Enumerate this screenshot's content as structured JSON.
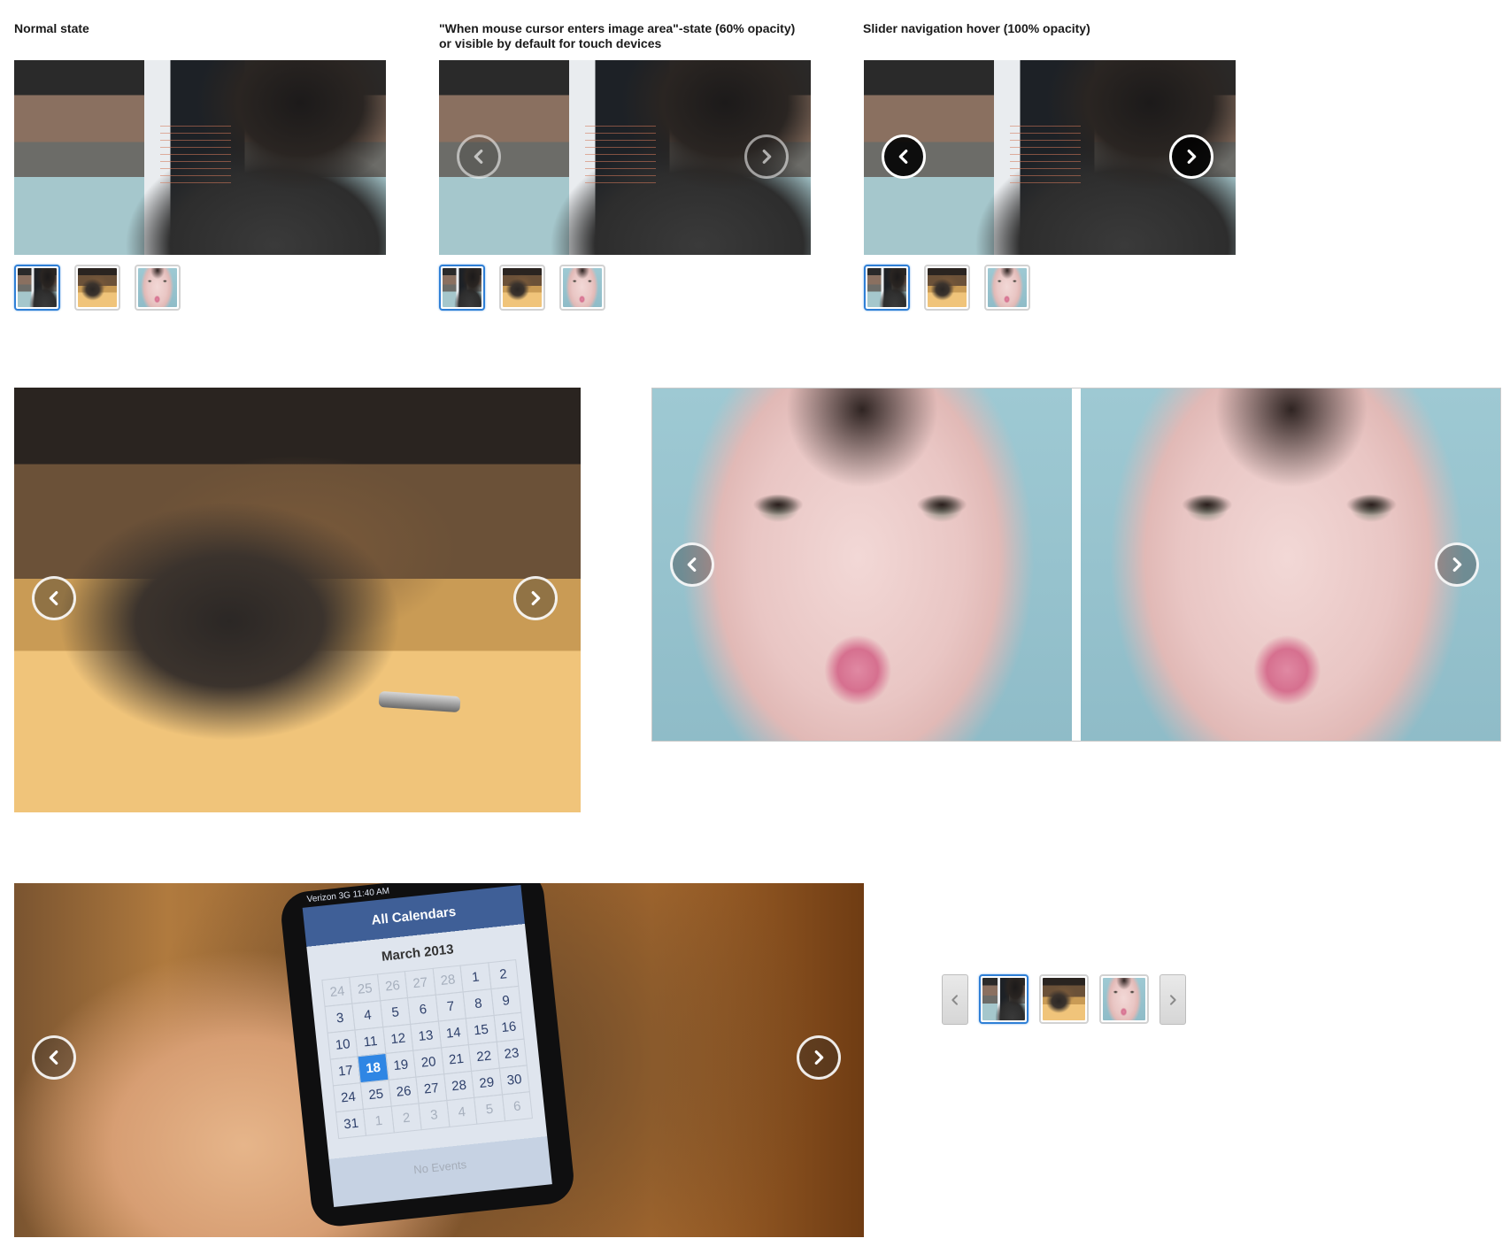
{
  "labels": {
    "normal": "Normal state",
    "hover_line1": "\"When mouse cursor enters image area\"-state (60% opacity)",
    "hover_line2": "or visible by default for touch devices",
    "nav_hover": "Slider navigation hover (100% opacity)"
  },
  "thumbnails": [
    "desk-thumbnail",
    "headphones-thumbnail",
    "face-thumbnail"
  ],
  "active_thumbnail": 0,
  "phone_calendar": {
    "status": "Verizon 3G  11:40 AM",
    "title": "All Calendars",
    "month": "March 2013",
    "days": [
      "24",
      "25",
      "26",
      "27",
      "28",
      "1",
      "2",
      "3",
      "4",
      "5",
      "6",
      "7",
      "8",
      "9",
      "10",
      "11",
      "12",
      "13",
      "14",
      "15",
      "16",
      "17",
      "18",
      "19",
      "20",
      "21",
      "22",
      "23",
      "24",
      "25",
      "26",
      "27",
      "28",
      "29",
      "30",
      "31",
      "1",
      "2",
      "3",
      "4",
      "5",
      "6"
    ],
    "today": "18",
    "footer": "No Events"
  },
  "colors": {
    "active_border": "#2f7fd6",
    "nav_hover_fill": "#000000"
  },
  "icons": {
    "prev": "chevron-left-icon",
    "next": "chevron-right-icon"
  }
}
